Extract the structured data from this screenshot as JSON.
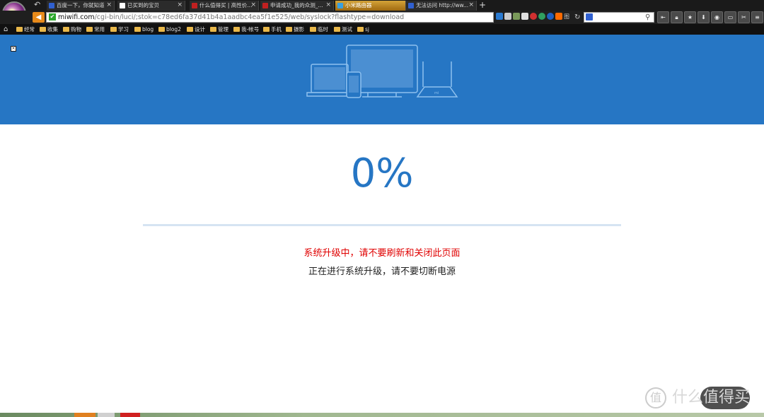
{
  "browser": {
    "tabs": [
      {
        "label": "百度一下，你就知道",
        "favicon_color": "#3060d0",
        "active": false
      },
      {
        "label": "已买到的宝贝",
        "favicon_color": "#ffffff",
        "active": false
      },
      {
        "label": "什么值得买 | 高性价...",
        "favicon_color": "#c02020",
        "active": false
      },
      {
        "label": "申请成功_我的众测_...",
        "favicon_color": "#c02020",
        "active": false
      },
      {
        "label": "小米路由器",
        "favicon_color": "#3aa0e0",
        "active": true
      },
      {
        "label": "无法访问 http://ww...",
        "favicon_color": "#3060d0",
        "active": false
      }
    ],
    "new_tab_label": "+",
    "url_host": "miwifi.com",
    "url_path": "/cgi-bin/luci/;stok=c78ed6fa37d41b4a1aadbc4ea5f1e525/web/syslock?flashtype=download",
    "addon_label": "图",
    "bookmarks": [
      "经常",
      "收集",
      "购物",
      "常用",
      "学习",
      "blog",
      "blog2",
      "设计",
      "管理",
      "我-帐号",
      "手机",
      "摄影",
      "临时",
      "测试",
      "sj"
    ]
  },
  "page": {
    "progress_text": "0%",
    "progress_value": 0,
    "warning_text": "系统升级中，请不要刷新和关闭此页面",
    "notice_text": "正在进行系统升级，请不要切断电源",
    "colors": {
      "accent": "#2676c4",
      "warning": "#e00000"
    }
  },
  "watermark": {
    "text": "什么值得买"
  }
}
